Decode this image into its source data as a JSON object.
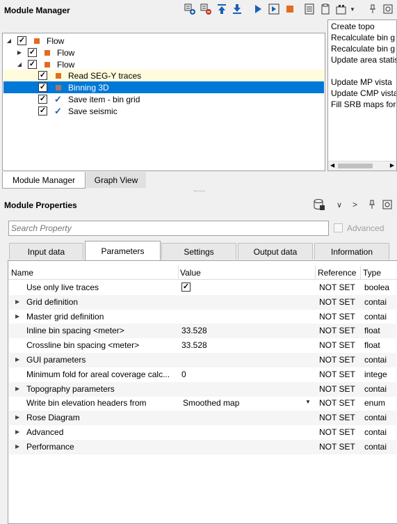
{
  "top_panel": {
    "title": "Module Manager"
  },
  "tree": [
    {
      "label": "Flow",
      "checked": true
    },
    {
      "label": "Flow",
      "checked": true
    },
    {
      "label": "Flow",
      "checked": true
    },
    {
      "label": "Read SEG-Y traces",
      "checked": true
    },
    {
      "label": "Binning 3D",
      "checked": true
    },
    {
      "label": "Save item - bin grid",
      "checked": true
    },
    {
      "label": "Save seismic",
      "checked": true
    }
  ],
  "log_lines": [
    "Create topo",
    "Recalculate bin g",
    "Recalculate bin g",
    "Update area statis",
    "",
    "Update MP vista",
    "Update CMP vista",
    "Fill SRB maps for"
  ],
  "bottom_tabs": {
    "module_manager": "Module Manager",
    "graph_view": "Graph View"
  },
  "properties": {
    "title": "Module Properties",
    "search_placeholder": "Search Property",
    "advanced_label": "Advanced",
    "tabs": [
      "Input data",
      "Parameters",
      "Settings",
      "Output data",
      "Information"
    ],
    "columns": {
      "name": "Name",
      "value": "Value",
      "reference": "Reference",
      "type": "Type"
    },
    "rows": [
      {
        "name": "Use only live traces",
        "value": "",
        "checkbox": true,
        "reference": "NOT SET",
        "type": "boolea",
        "expandable": false
      },
      {
        "name": "Grid definition",
        "value": "",
        "reference": "NOT SET",
        "type": "contai",
        "expandable": true
      },
      {
        "name": "Master grid definition",
        "value": "",
        "reference": "NOT SET",
        "type": "contai",
        "expandable": true
      },
      {
        "name": "Inline bin spacing <meter>",
        "value": "33.528",
        "reference": "NOT SET",
        "type": "float",
        "expandable": false
      },
      {
        "name": "Crossline bin spacing <meter>",
        "value": "33.528",
        "reference": "NOT SET",
        "type": "float",
        "expandable": false
      },
      {
        "name": "GUI parameters",
        "value": "",
        "reference": "NOT SET",
        "type": "contai",
        "expandable": true
      },
      {
        "name": "Minimum fold for areal coverage calc...",
        "value": "0",
        "reference": "NOT SET",
        "type": "intege",
        "expandable": false
      },
      {
        "name": "Topography parameters",
        "value": "",
        "reference": "NOT SET",
        "type": "contai",
        "expandable": true
      },
      {
        "name": "Write bin elevation headers from",
        "value": "Smoothed map",
        "dropdown": true,
        "reference": "NOT SET",
        "type": "enum",
        "expandable": false
      },
      {
        "name": "Rose Diagram",
        "value": "",
        "reference": "NOT SET",
        "type": "contai",
        "expandable": true
      },
      {
        "name": "Advanced",
        "value": "",
        "reference": "NOT SET",
        "type": "contai",
        "expandable": true
      },
      {
        "name": "Performance",
        "value": "",
        "reference": "NOT SET",
        "type": "contai",
        "expandable": true
      }
    ]
  }
}
